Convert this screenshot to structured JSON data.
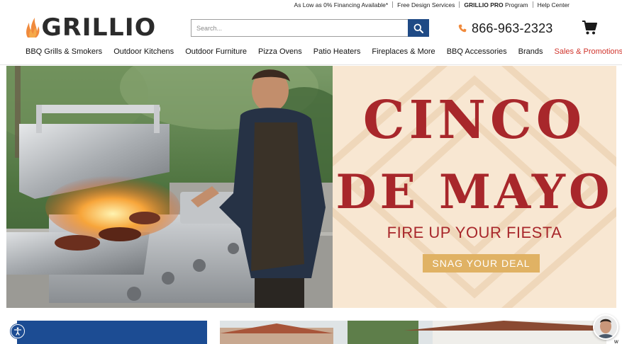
{
  "utility": {
    "financing": "As Low as 0% Financing Available*",
    "design": "Free Design Services",
    "pro_bold": "GRILLIO PRO",
    "pro_rest": " Program",
    "help": "Help Center"
  },
  "header": {
    "logo_text": "GRILLIO",
    "search_placeholder": "Search...",
    "phone": "866-963-2323",
    "icons": [
      "flame-icon",
      "search-icon",
      "phone-icon",
      "cart-icon"
    ]
  },
  "nav": {
    "items": [
      "BBQ Grills & Smokers",
      "Outdoor Kitchens",
      "Outdoor Furniture",
      "Pizza Ovens",
      "Patio Heaters",
      "Fireplaces & More",
      "BBQ Accessories",
      "Brands"
    ],
    "promo": "Sales & Promotions"
  },
  "hero": {
    "line1": "CINCO",
    "line2": "DE MAYO",
    "tagline": "FIRE UP YOUR FIESTA",
    "cta": "SNAG YOUR DEAL"
  },
  "chat": {
    "letter": "w"
  },
  "colors": {
    "brand_blue": "#1f4a85",
    "promo_red": "#d0342c",
    "hero_red": "#a8272b",
    "hero_bg": "#f8e7d2",
    "cta_gold": "#e0b264",
    "flame_orange": "#f08a3c"
  }
}
